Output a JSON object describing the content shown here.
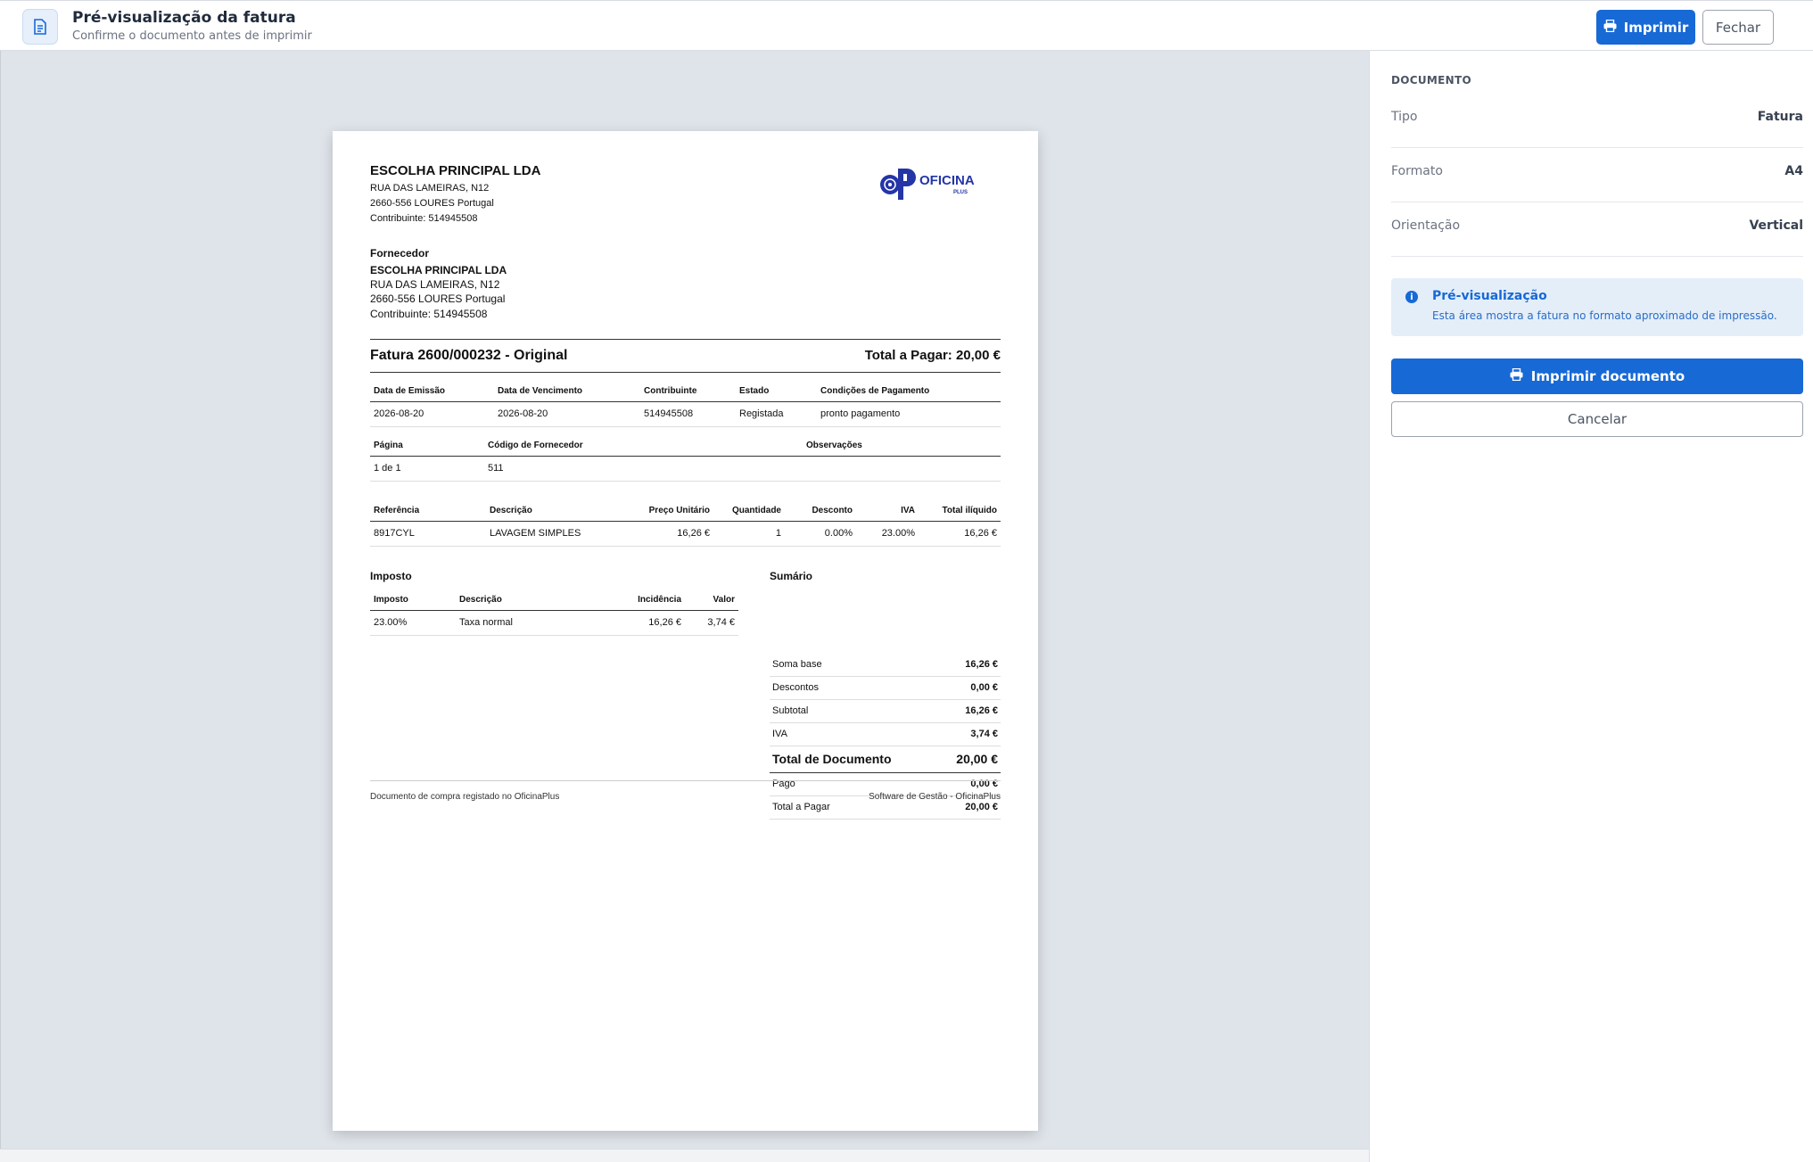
{
  "header": {
    "title": "Pré-visualização da fatura",
    "subtitle": "Confirme o documento antes de imprimir",
    "print_label": "Imprimir",
    "close_label": "Fechar"
  },
  "invoice": {
    "company": {
      "name": "ESCOLHA PRINCIPAL LDA",
      "address": "RUA DAS LAMEIRAS, N12",
      "city": "2660-556 LOURES Portugal",
      "tax_id": "Contribuinte: 514945508"
    },
    "logo": {
      "main": "OFICINA",
      "sub": "PLUS"
    },
    "supplier": {
      "label": "Fornecedor",
      "name": "ESCOLHA PRINCIPAL LDA",
      "address": "RUA DAS LAMEIRAS, N12",
      "city": "2660-556 LOURES Portugal",
      "tax_id": "Contribuinte: 514945508"
    },
    "title": "Fatura 2600/000232 - Original",
    "total_to_pay": "Total a Pagar: 20,00 €",
    "meta1": {
      "headers": [
        "Data de Emissão",
        "Data de Vencimento",
        "Contribuinte",
        "Estado",
        "Condições de Pagamento"
      ],
      "values": [
        "2026-08-20",
        "2026-08-20",
        "514945508",
        "Registada",
        "pronto pagamento"
      ]
    },
    "meta2": {
      "headers": [
        "Página",
        "Código de Fornecedor",
        "Observações"
      ],
      "values": [
        "1 de 1",
        "511",
        ""
      ]
    },
    "lines": {
      "headers": [
        "Referência",
        "Descrição",
        "Preço Unitário",
        "Quantidade",
        "Desconto",
        "IVA",
        "Total ilíquido"
      ],
      "rows": [
        [
          "8917CYL",
          "LAVAGEM SIMPLES",
          "16,26 €",
          "1",
          "0.00%",
          "23.00%",
          "16,26 €"
        ]
      ]
    },
    "tax": {
      "title": "Imposto",
      "headers": [
        "Imposto",
        "Descrição",
        "Incidência",
        "Valor"
      ],
      "rows": [
        [
          "23.00%",
          "Taxa normal",
          "16,26 €",
          "3,74 €"
        ]
      ]
    },
    "summary": {
      "title": "Sumário",
      "rows": [
        {
          "label": "Soma base",
          "value": "16,26 €"
        },
        {
          "label": "Descontos",
          "value": "0,00 €"
        },
        {
          "label": "Subtotal",
          "value": "16,26 €"
        },
        {
          "label": "IVA",
          "value": "3,74 €"
        },
        {
          "label": "Total de Documento",
          "value": "20,00 €"
        },
        {
          "label": "Pago",
          "value": "0,00 €"
        },
        {
          "label": "Total a Pagar",
          "value": "20,00 €"
        }
      ]
    },
    "footer": {
      "left": "Documento de compra registado no OficinaPlus",
      "right": "Software de Gestão - OficinaPlus"
    }
  },
  "panel": {
    "heading": "DOCUMENTO",
    "props": [
      {
        "label": "Tipo",
        "value": "Fatura"
      },
      {
        "label": "Formato",
        "value": "A4"
      },
      {
        "label": "Orientação",
        "value": "Vertical"
      }
    ],
    "info_title": "Pré-visualização",
    "info_text": "Esta área mostra a fatura no formato aproximado de impressão.",
    "print_doc_label": "Imprimir documento",
    "cancel_label": "Cancelar"
  },
  "colors": {
    "primary": "#1769d6",
    "preview_bg": "#dfe4ea",
    "info_bg": "#e4eef9"
  },
  "icons": [
    "document-icon",
    "printer-icon",
    "info-icon"
  ]
}
